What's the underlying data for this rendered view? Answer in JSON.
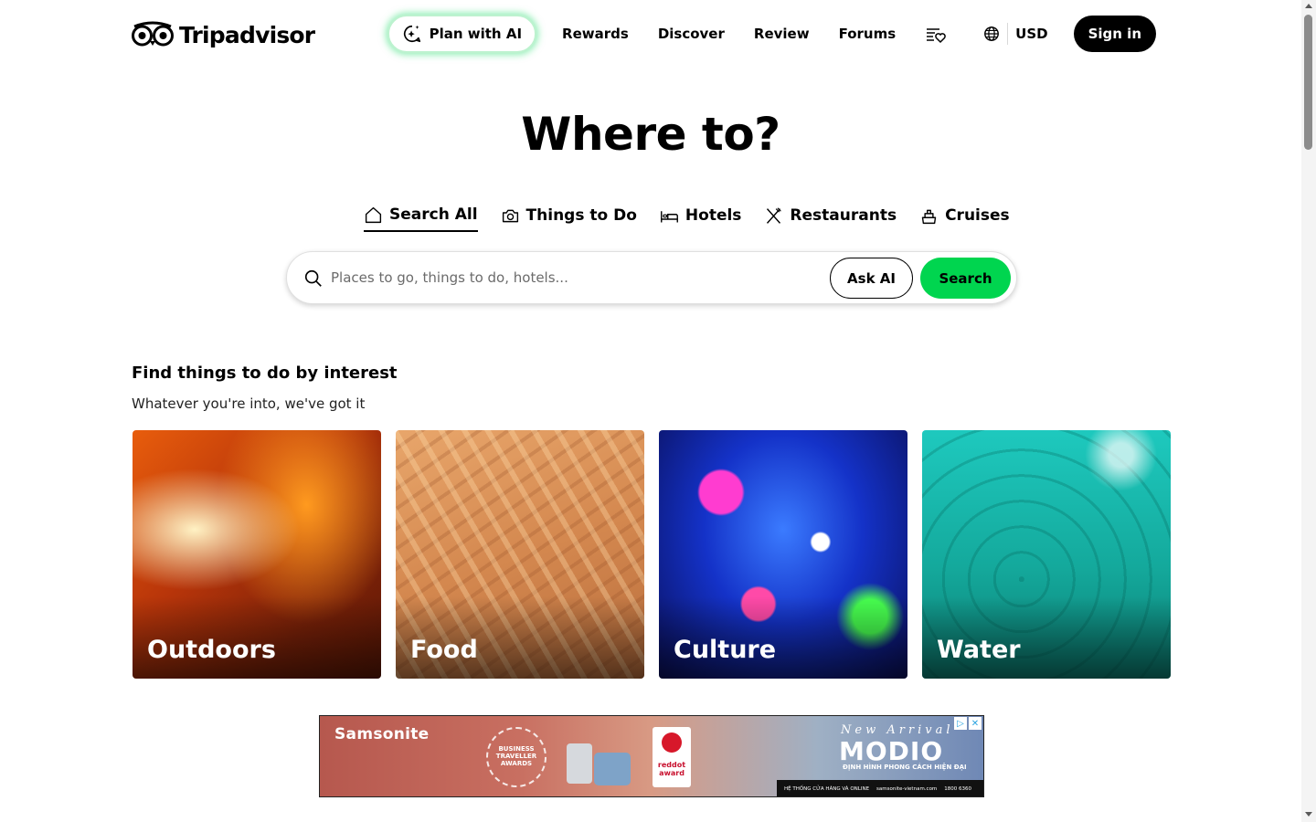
{
  "header": {
    "logo_text": "Tripadvisor",
    "plan_ai_label": "Plan with AI",
    "nav_links": [
      "Rewards",
      "Discover",
      "Review",
      "Forums"
    ],
    "currency": "USD",
    "signin_label": "Sign in"
  },
  "hero": {
    "title": "Where to?",
    "tabs": [
      {
        "label": "Search All",
        "icon": "home-icon",
        "active": true
      },
      {
        "label": "Things to Do",
        "icon": "camera-icon",
        "active": false
      },
      {
        "label": "Hotels",
        "icon": "bed-icon",
        "active": false
      },
      {
        "label": "Restaurants",
        "icon": "fork-knife-icon",
        "active": false
      },
      {
        "label": "Cruises",
        "icon": "ship-icon",
        "active": false
      }
    ],
    "search": {
      "placeholder": "Places to go, things to do, hotels...",
      "ask_ai_label": "Ask AI",
      "search_label": "Search"
    }
  },
  "interests": {
    "title": "Find things to do by interest",
    "subtitle": "Whatever you're into, we've got it",
    "cards": [
      "Outdoors",
      "Food",
      "Culture",
      "Water"
    ]
  },
  "ad": {
    "brand": "Samsonite",
    "award_text": "BUSINESS TRAVELLER AWARDS",
    "reddot_text": "reddot award",
    "new_arrival": "New Arrival",
    "model": "MODIO",
    "tagline": "ĐỊNH HÌNH PHONG CÁCH HIỆN ĐẠI",
    "strip": [
      "HỆ THỐNG CỬA HÀNG VÀ ONLINE",
      "samsonite-vietnam.com",
      "1800 6360"
    ]
  },
  "colors": {
    "brand_dark": "#000000",
    "search_green": "#00d54f",
    "ai_glow": "#34e078"
  }
}
